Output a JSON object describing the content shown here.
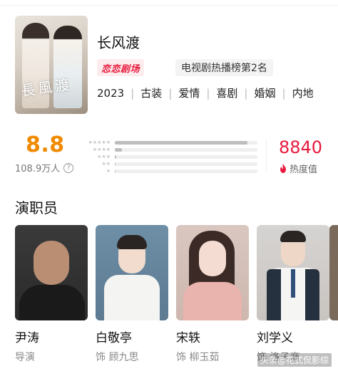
{
  "show": {
    "title": "长风渡",
    "poster_title": "長風渡",
    "platform_badge": "恋恋剧场",
    "rank_badge": "电视剧热播榜第2名",
    "tags": [
      "2023",
      "古装",
      "爱情",
      "喜剧",
      "婚姻",
      "内地"
    ]
  },
  "rating": {
    "score": "8.8",
    "votes": "108.9万人",
    "help_icon": "?",
    "distribution_fraction": [
      0.93,
      0.05,
      0.01,
      0.005,
      0.005
    ],
    "heat_value": "8840",
    "heat_label": "热度值"
  },
  "cast": {
    "section_title": "演职员",
    "members": [
      {
        "name": "尹涛",
        "role": "导演"
      },
      {
        "name": "白敬亭",
        "role": "饰 顾九思"
      },
      {
        "name": "宋轶",
        "role": "饰 柳玉茹"
      },
      {
        "name": "刘学义",
        "role": "饰 洛子商"
      }
    ]
  },
  "watermark": "头条@花式侃影综",
  "colors": {
    "score": "#f08a00",
    "heat": "#e8193c",
    "brand": "#e8193c"
  },
  "icons": {
    "help": "question-circle-icon",
    "heat": "flame-icon",
    "star": "star-icon"
  }
}
